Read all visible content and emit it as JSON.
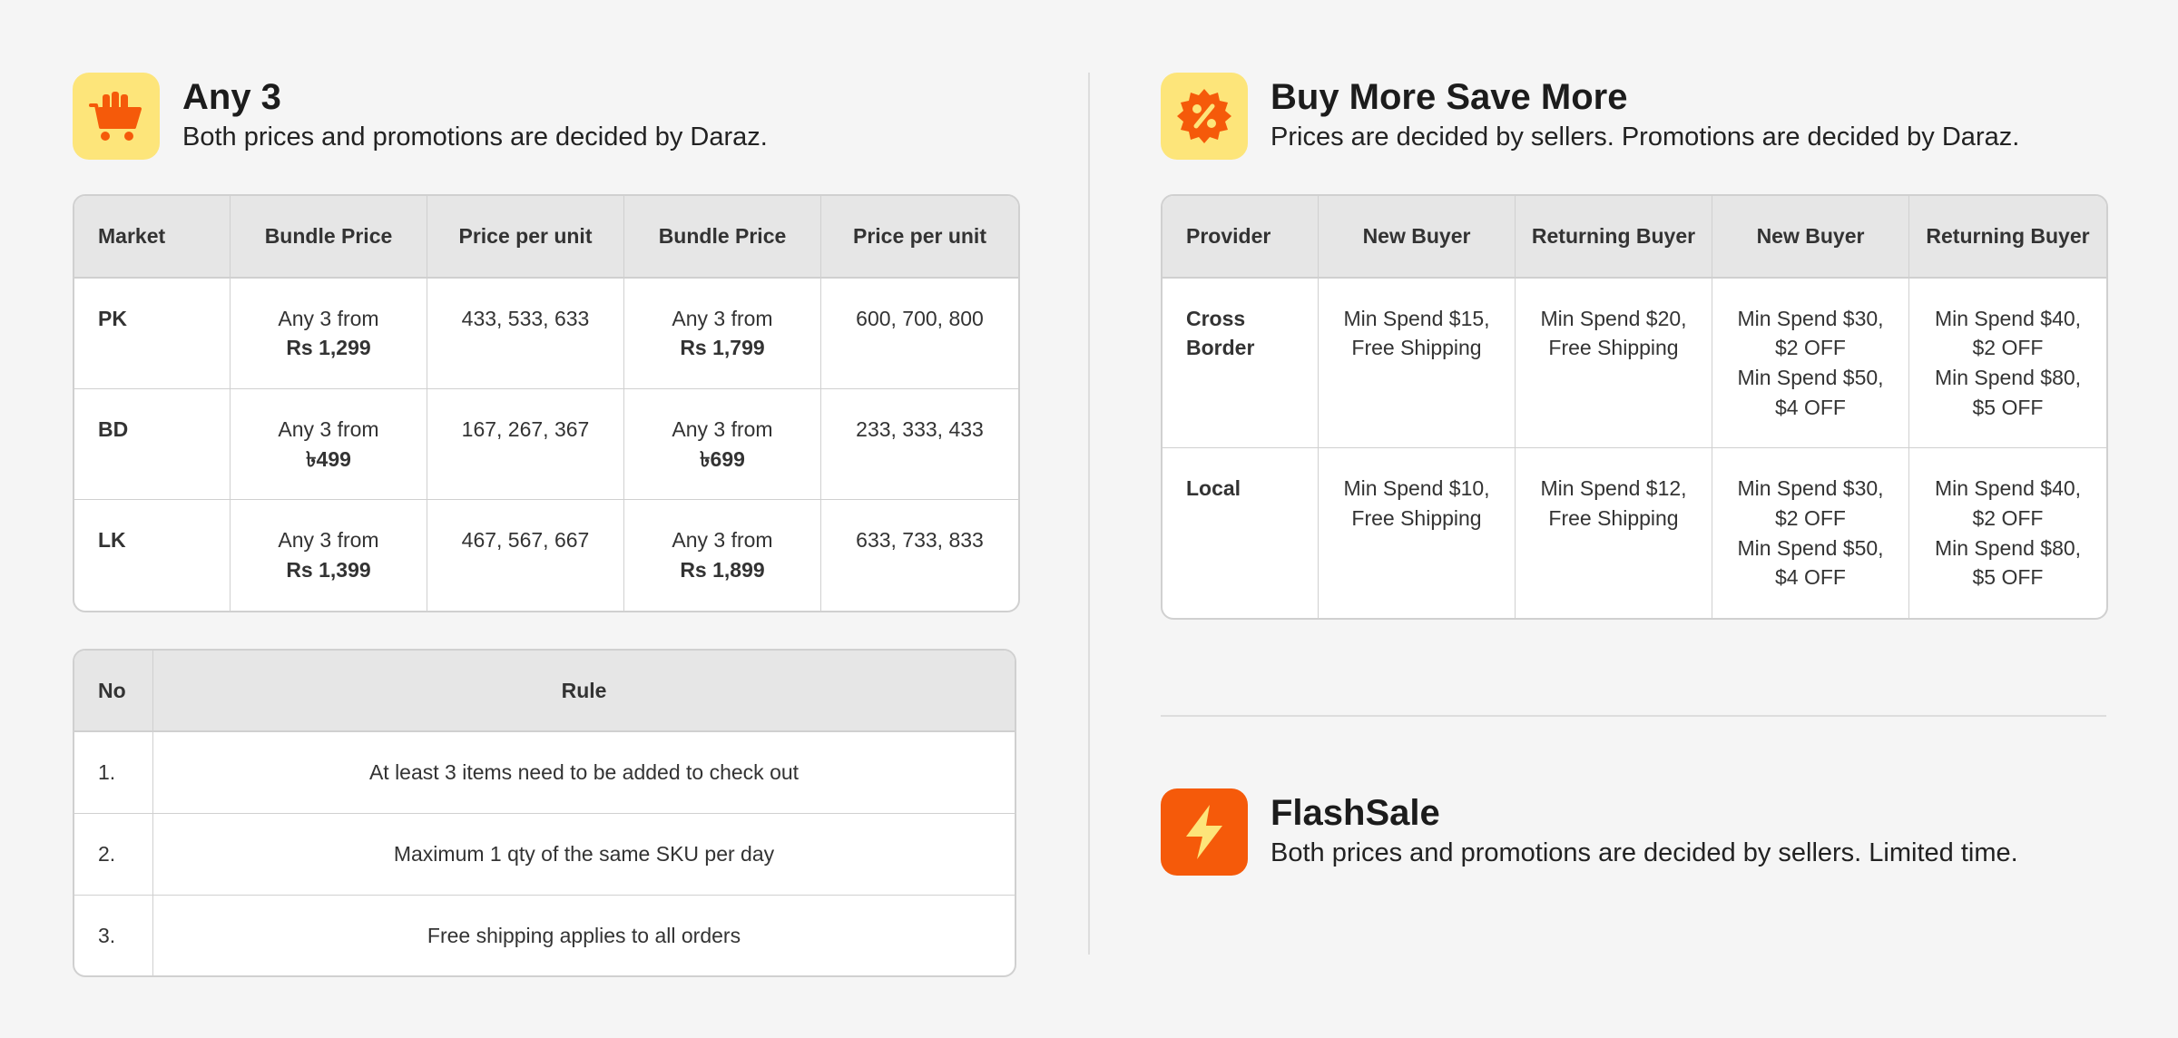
{
  "any3": {
    "icon": "shopping-cart-icon",
    "title": "Any 3",
    "subtitle": "Both prices and promotions are decided by Daraz.",
    "headers": [
      "Market",
      "Bundle Price",
      "Price per unit",
      "Bundle Price",
      "Price per unit"
    ],
    "rows": [
      {
        "market": "PK",
        "bundle1_prefix": "Any 3 from",
        "bundle1_price": "Rs 1,299",
        "unit1": "433, 533, 633",
        "bundle2_prefix": "Any 3 from",
        "bundle2_price": "Rs 1,799",
        "unit2": "600, 700, 800"
      },
      {
        "market": "BD",
        "bundle1_prefix": "Any 3 from",
        "bundle1_price": "৳499",
        "unit1": "167, 267, 367",
        "bundle2_prefix": "Any 3 from",
        "bundle2_price": "৳699",
        "unit2": "233, 333, 433"
      },
      {
        "market": "LK",
        "bundle1_prefix": "Any 3 from",
        "bundle1_price": "Rs 1,399",
        "unit1": "467, 567, 667",
        "bundle2_prefix": "Any 3 from",
        "bundle2_price": "Rs 1,899",
        "unit2": "633, 733, 833"
      }
    ]
  },
  "rules": {
    "headers": [
      "No",
      "Rule"
    ],
    "rows": [
      {
        "no": "1.",
        "rule": "At least 3 items need to be added to check out"
      },
      {
        "no": "2.",
        "rule": "Maximum 1 qty of the same SKU per day"
      },
      {
        "no": "3.",
        "rule": "Free shipping applies to all orders"
      }
    ]
  },
  "bmsm": {
    "icon": "percent-badge-icon",
    "title": "Buy More Save More",
    "subtitle": "Prices are decided by sellers. Promotions are decided by Daraz.",
    "headers": [
      "Provider",
      "New Buyer",
      "Returning Buyer",
      "New Buyer",
      "Returning Buyer"
    ],
    "rows": [
      {
        "provider_line1": "Cross",
        "provider_line2": "Border",
        "c1": [
          "Min Spend $15,",
          "Free Shipping"
        ],
        "c2": [
          "Min Spend $20,",
          "Free Shipping"
        ],
        "c3": [
          "Min Spend $30,",
          "$2 OFF",
          "Min Spend $50,",
          "$4 OFF"
        ],
        "c4": [
          "Min Spend $40,",
          "$2 OFF",
          "Min Spend $80,",
          "$5 OFF"
        ]
      },
      {
        "provider_line1": "Local",
        "provider_line2": "",
        "c1": [
          "Min Spend $10,",
          "Free Shipping"
        ],
        "c2": [
          "Min Spend $12,",
          "Free Shipping"
        ],
        "c3": [
          "Min Spend $30,",
          "$2 OFF",
          "Min Spend $50,",
          "$4 OFF"
        ],
        "c4": [
          "Min Spend $40,",
          "$2 OFF",
          "Min Spend $80,",
          "$5 OFF"
        ]
      }
    ]
  },
  "flashsale": {
    "icon": "lightning-bolt-icon",
    "title": "FlashSale",
    "subtitle": "Both prices and promotions are decided by sellers. Limited time."
  },
  "colors": {
    "background": "#f5f5f5",
    "icon_yellow": "#fde57a",
    "icon_orange": "#f55a0a",
    "table_header": "#e6e6e6",
    "border": "#d0d0d0"
  }
}
